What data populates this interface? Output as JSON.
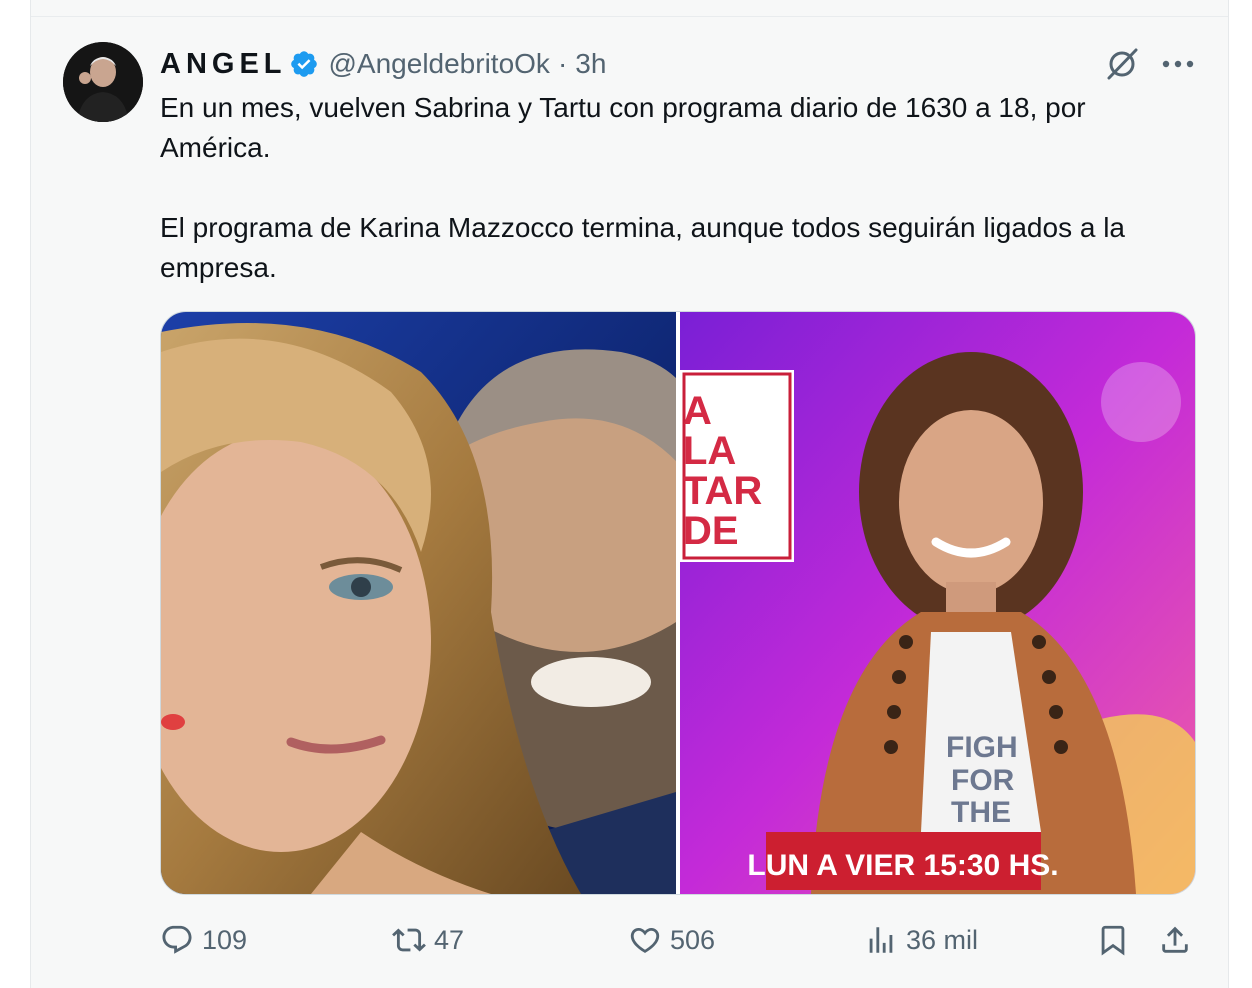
{
  "tweet": {
    "author_name": "ANGEL",
    "handle": "@AngeldebritoOk",
    "separator": "·",
    "time": "3h",
    "text_paragraph_1": "En un mes, vuelven Sabrina y Tartu con programa diario de 1630 a 18, por América.",
    "text_paragraph_2": "El programa de Karina Mazzocco termina, aunque todos seguirán ligados a la empresa.",
    "media": {
      "left_image": "sabrina-and-tartu-photo",
      "right_image": "karina-mazzocco-photo",
      "right_logo_lines": [
        "A",
        "LA",
        "TAR",
        "DE"
      ],
      "right_banner": "LUN A VIER 15:30 HS.",
      "right_shirt_lines": [
        "FIGH",
        "FOR",
        "THE"
      ]
    },
    "actions": {
      "replies": "109",
      "reposts": "47",
      "likes": "506",
      "views": "36 mil"
    }
  },
  "icons": {
    "verified": "verified-badge-icon",
    "grok": "grok-icon",
    "more": "more-options-icon",
    "reply": "reply-icon",
    "repost": "repost-icon",
    "like": "heart-icon",
    "views": "views-icon",
    "bookmark": "bookmark-icon",
    "share": "share-icon"
  },
  "colors": {
    "text": "#0f1419",
    "secondary": "#536471",
    "verified": "#1d9bf0",
    "border": "#cfd9de"
  }
}
